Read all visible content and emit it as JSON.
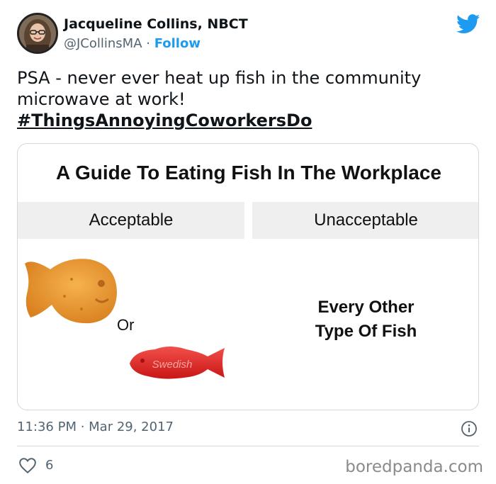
{
  "author": {
    "name": "Jacqueline Collins, NBCT",
    "handle": "@JCollinsMA",
    "separator": " · ",
    "follow_label": "Follow"
  },
  "tweet": {
    "text": "PSA - never ever heat up fish in the community microwave at work!",
    "hashtag": "#ThingsAnnoyingCoworkersDo"
  },
  "card": {
    "title": "A Guide To Eating Fish In The Workplace",
    "left_header": "Acceptable",
    "right_header": "Unacceptable",
    "or_label": "Or",
    "candy_text": "Swedish",
    "right_line1": "Every Other",
    "right_line2": "Type Of Fish"
  },
  "meta": {
    "timestamp": "11:36 PM · Mar 29, 2017",
    "likes": "6",
    "watermark": "boredpanda.com"
  },
  "icons": {
    "brand": "twitter-bird-icon",
    "info": "info-icon",
    "like": "heart-icon"
  },
  "colors": {
    "accent": "#1d9bf0",
    "text": "#0f1419",
    "muted": "#536471",
    "goldfish": "#e89a3a",
    "swedish_fish": "#e52b2b"
  }
}
